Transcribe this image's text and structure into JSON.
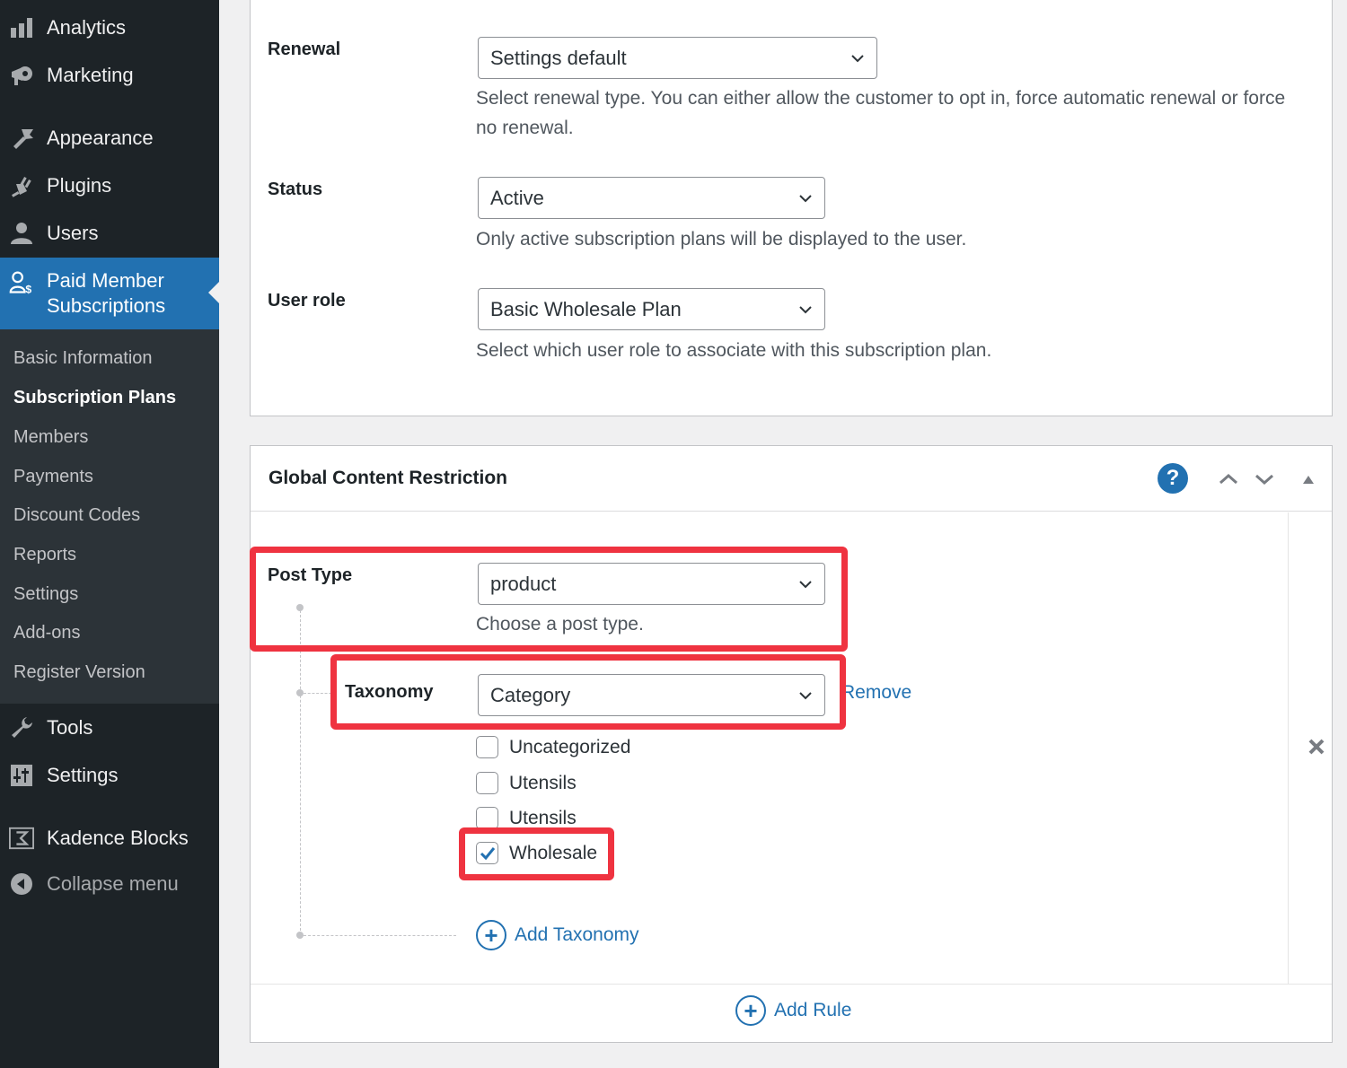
{
  "sidebar": {
    "menu": [
      {
        "id": "analytics",
        "label": "Analytics",
        "icon": "bar-chart-icon"
      },
      {
        "id": "marketing",
        "label": "Marketing",
        "icon": "megaphone-icon"
      },
      {
        "id": "appearance",
        "label": "Appearance",
        "icon": "paintbrush-icon"
      },
      {
        "id": "plugins",
        "label": "Plugins",
        "icon": "plug-icon"
      },
      {
        "id": "users",
        "label": "Users",
        "icon": "user-icon"
      },
      {
        "id": "pms",
        "label_line1": "Paid Member",
        "label_line2": "Subscriptions",
        "icon": "member-dollar-icon"
      },
      {
        "id": "tools",
        "label": "Tools",
        "icon": "wrench-icon"
      },
      {
        "id": "settings",
        "label": "Settings",
        "icon": "sliders-icon"
      },
      {
        "id": "kadence",
        "label": "Kadence Blocks",
        "icon": "kadence-icon"
      },
      {
        "id": "collapse",
        "label": "Collapse menu",
        "icon": "collapse-arrow-icon"
      }
    ],
    "submenu": [
      {
        "label": "Basic Information"
      },
      {
        "label": "Subscription Plans",
        "current": true
      },
      {
        "label": "Members"
      },
      {
        "label": "Payments"
      },
      {
        "label": "Discount Codes"
      },
      {
        "label": "Reports"
      },
      {
        "label": "Settings"
      },
      {
        "label": "Add-ons"
      },
      {
        "label": "Register Version"
      }
    ]
  },
  "plan_details": {
    "renewal": {
      "label": "Renewal",
      "value": "Settings default",
      "description": "Select renewal type. You can either allow the customer to opt in, force automatic renewal or force no renewal."
    },
    "status": {
      "label": "Status",
      "value": "Active",
      "description": "Only active subscription plans will be displayed to the user."
    },
    "user_role": {
      "label": "User role",
      "value": "Basic Wholesale Plan",
      "description": "Select which user role to associate with this subscription plan."
    }
  },
  "global_content_restriction": {
    "title": "Global Content Restriction",
    "help_icon": "?",
    "post_type": {
      "label": "Post Type",
      "value": "product",
      "description": "Choose a post type."
    },
    "taxonomy": {
      "label": "Taxonomy",
      "value": "Category",
      "remove_label": "Remove",
      "terms": [
        {
          "label": "Uncategorized",
          "checked": false
        },
        {
          "label": "Utensils",
          "checked": false
        },
        {
          "label": "Utensils",
          "checked": false
        },
        {
          "label": "Wholesale",
          "checked": true
        }
      ]
    },
    "add_taxonomy_label": "Add Taxonomy",
    "add_rule_label": "Add Rule"
  },
  "colors": {
    "accent": "#2271b1",
    "highlight": "#ef3340",
    "sidebar_bg": "#1d2327",
    "submenu_bg": "#2c3338"
  }
}
